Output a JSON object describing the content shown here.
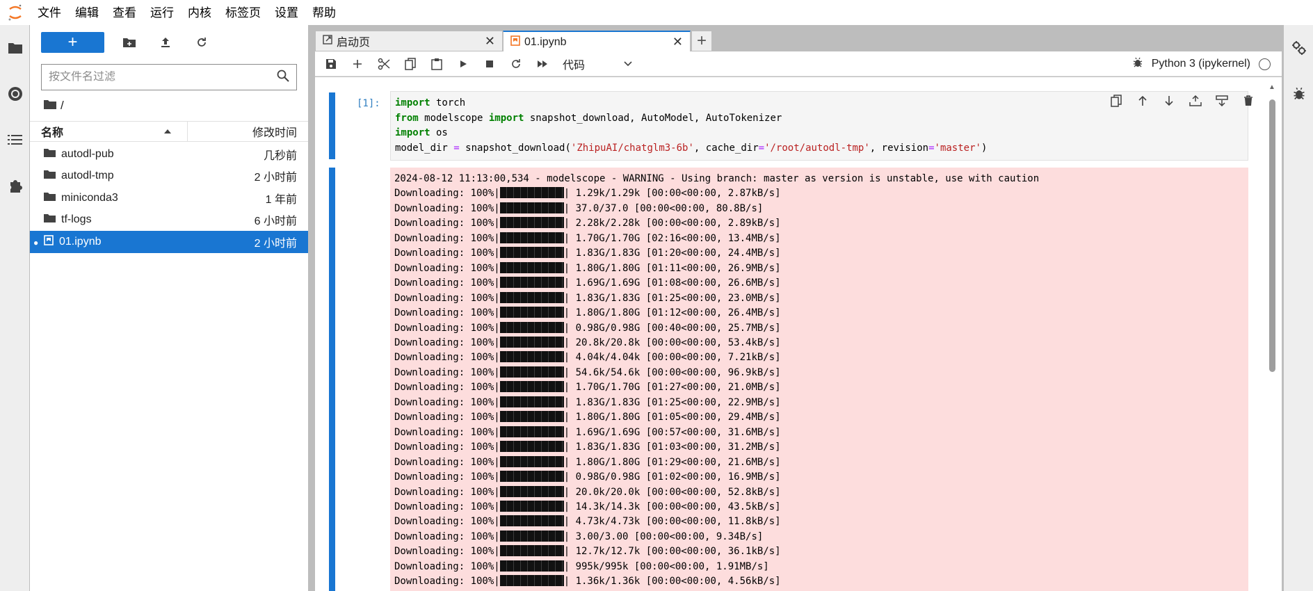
{
  "menubar": {
    "items": [
      "文件",
      "编辑",
      "查看",
      "运行",
      "内核",
      "标签页",
      "设置",
      "帮助"
    ]
  },
  "left_activity": {
    "icons": [
      "folder-icon",
      "running-icon",
      "toc-icon",
      "extension-icon"
    ]
  },
  "filebrowser": {
    "new_label": "+",
    "filter_placeholder": "按文件名过滤",
    "breadcrumb": "/",
    "header_name": "名称",
    "header_modified": "修改时间",
    "files": [
      {
        "name": "autodl-pub",
        "time": "几秒前",
        "type": "folder"
      },
      {
        "name": "autodl-tmp",
        "time": "2 小时前",
        "type": "folder"
      },
      {
        "name": "miniconda3",
        "time": "1 年前",
        "type": "folder"
      },
      {
        "name": "tf-logs",
        "time": "6 小时前",
        "type": "folder"
      },
      {
        "name": "01.ipynb",
        "time": "2 小时前",
        "type": "notebook",
        "selected": true
      }
    ]
  },
  "tabs": [
    {
      "label": "启动页",
      "icon": "launcher-icon"
    },
    {
      "label": "01.ipynb",
      "icon": "notebook-icon",
      "active": true
    }
  ],
  "notebook_toolbar": {
    "cell_type": "代码",
    "kernel_name": "Python 3 (ipykernel)"
  },
  "cell": {
    "prompt": "[1]:",
    "code_lines": [
      "import torch",
      "from modelscope import snapshot_download, AutoModel, AutoTokenizer",
      "import os",
      "model_dir = snapshot_download('ZhipuAI/chatglm3-6b', cache_dir='/root/autodl-tmp', revision='master')"
    ],
    "warning": "2024-08-12 11:13:00,534 - modelscope - WARNING - Using branch: master as version is unstable, use with caution",
    "download_prefix": "Downloading: 100%|",
    "downloads": [
      "1.29k/1.29k [00:00<00:00, 2.87kB/s]",
      "37.0/37.0 [00:00<00:00, 80.8B/s]",
      "2.28k/2.28k [00:00<00:00, 2.89kB/s]",
      "1.70G/1.70G [02:16<00:00, 13.4MB/s]",
      "1.83G/1.83G [01:20<00:00, 24.4MB/s]",
      "1.80G/1.80G [01:11<00:00, 26.9MB/s]",
      "1.69G/1.69G [01:08<00:00, 26.6MB/s]",
      "1.83G/1.83G [01:25<00:00, 23.0MB/s]",
      "1.80G/1.80G [01:12<00:00, 26.4MB/s]",
      "0.98G/0.98G [00:40<00:00, 25.7MB/s]",
      "20.8k/20.8k [00:00<00:00, 53.4kB/s]",
      "4.04k/4.04k [00:00<00:00, 7.21kB/s]",
      "54.6k/54.6k [00:00<00:00, 96.9kB/s]",
      "1.70G/1.70G [01:27<00:00, 21.0MB/s]",
      "1.83G/1.83G [01:25<00:00, 22.9MB/s]",
      "1.80G/1.80G [01:05<00:00, 29.4MB/s]",
      "1.69G/1.69G [00:57<00:00, 31.6MB/s]",
      "1.83G/1.83G [01:03<00:00, 31.2MB/s]",
      "1.80G/1.80G [01:29<00:00, 21.6MB/s]",
      "0.98G/0.98G [01:02<00:00, 16.9MB/s]",
      "20.0k/20.0k [00:00<00:00, 52.8kB/s]",
      "14.3k/14.3k [00:00<00:00, 43.5kB/s]",
      "4.73k/4.73k [00:00<00:00, 11.8kB/s]",
      "3.00/3.00 [00:00<00:00, 9.34B/s]",
      "12.7k/12.7k [00:00<00:00, 36.1kB/s]",
      "995k/995k [00:00<00:00, 1.91MB/s]",
      "1.36k/1.36k [00:00<00:00, 4.56kB/s]"
    ]
  },
  "colors": {
    "accent": "#1976d2",
    "output_bg": "#fddddd"
  }
}
